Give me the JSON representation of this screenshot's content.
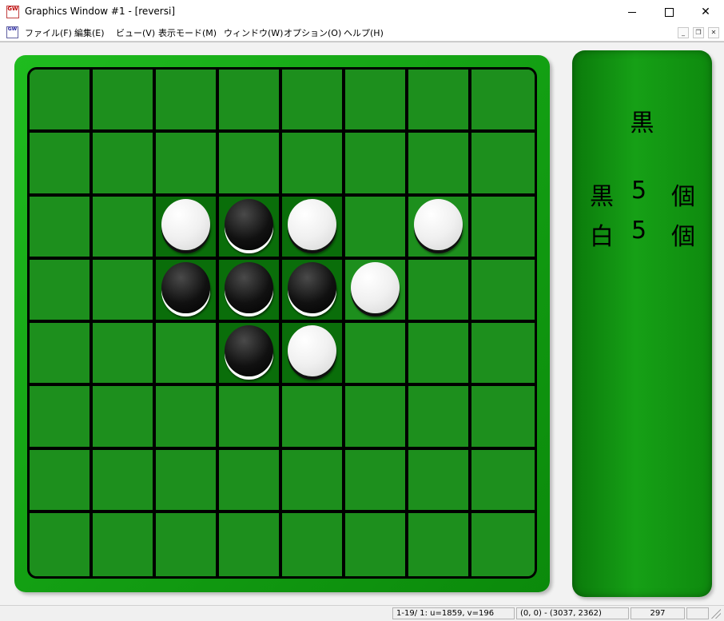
{
  "window": {
    "title": "Graphics Window #1 - [reversi]",
    "icon_text": "GW",
    "controls": {
      "minimize": "—",
      "maximize": "☐",
      "close": "✕"
    }
  },
  "menu": {
    "items": [
      {
        "label": "ファイル(F)"
      },
      {
        "label": "編集(E)"
      },
      {
        "label": "ビュー(V)"
      },
      {
        "label": "表示モード(M)"
      },
      {
        "label": "ウィンドウ(W)"
      },
      {
        "label": "オプション(O)"
      },
      {
        "label": "ヘルプ(H)"
      }
    ],
    "mdi_controls": {
      "minimize": "_",
      "restore": "❐",
      "close": "✕"
    }
  },
  "board": {
    "rows": 8,
    "cols": 8,
    "highlight_cells": [
      [
        2,
        2
      ],
      [
        2,
        3
      ],
      [
        2,
        4
      ],
      [
        3,
        2
      ],
      [
        3,
        3
      ],
      [
        3,
        4
      ],
      [
        4,
        3
      ],
      [
        4,
        4
      ]
    ],
    "discs": [
      {
        "row": 2,
        "col": 2,
        "color": "white"
      },
      {
        "row": 2,
        "col": 3,
        "color": "black"
      },
      {
        "row": 2,
        "col": 4,
        "color": "white"
      },
      {
        "row": 2,
        "col": 6,
        "color": "white"
      },
      {
        "row": 3,
        "col": 2,
        "color": "black"
      },
      {
        "row": 3,
        "col": 3,
        "color": "black"
      },
      {
        "row": 3,
        "col": 4,
        "color": "black"
      },
      {
        "row": 3,
        "col": 5,
        "color": "white"
      },
      {
        "row": 4,
        "col": 3,
        "color": "black"
      },
      {
        "row": 4,
        "col": 4,
        "color": "white"
      }
    ]
  },
  "panel": {
    "turn": "黒",
    "black_row": {
      "color": "黒",
      "count": "5",
      "unit": "個"
    },
    "white_row": {
      "color": "白",
      "count": "5",
      "unit": "個"
    }
  },
  "status": {
    "position": "1-19/ 1: u=1859, v=196",
    "range": "(0, 0) - (3037, 2362)",
    "value": "297"
  },
  "colors": {
    "board_green": "#1d8f1d",
    "frame_green": "#14a214",
    "grid_line": "#000000"
  }
}
